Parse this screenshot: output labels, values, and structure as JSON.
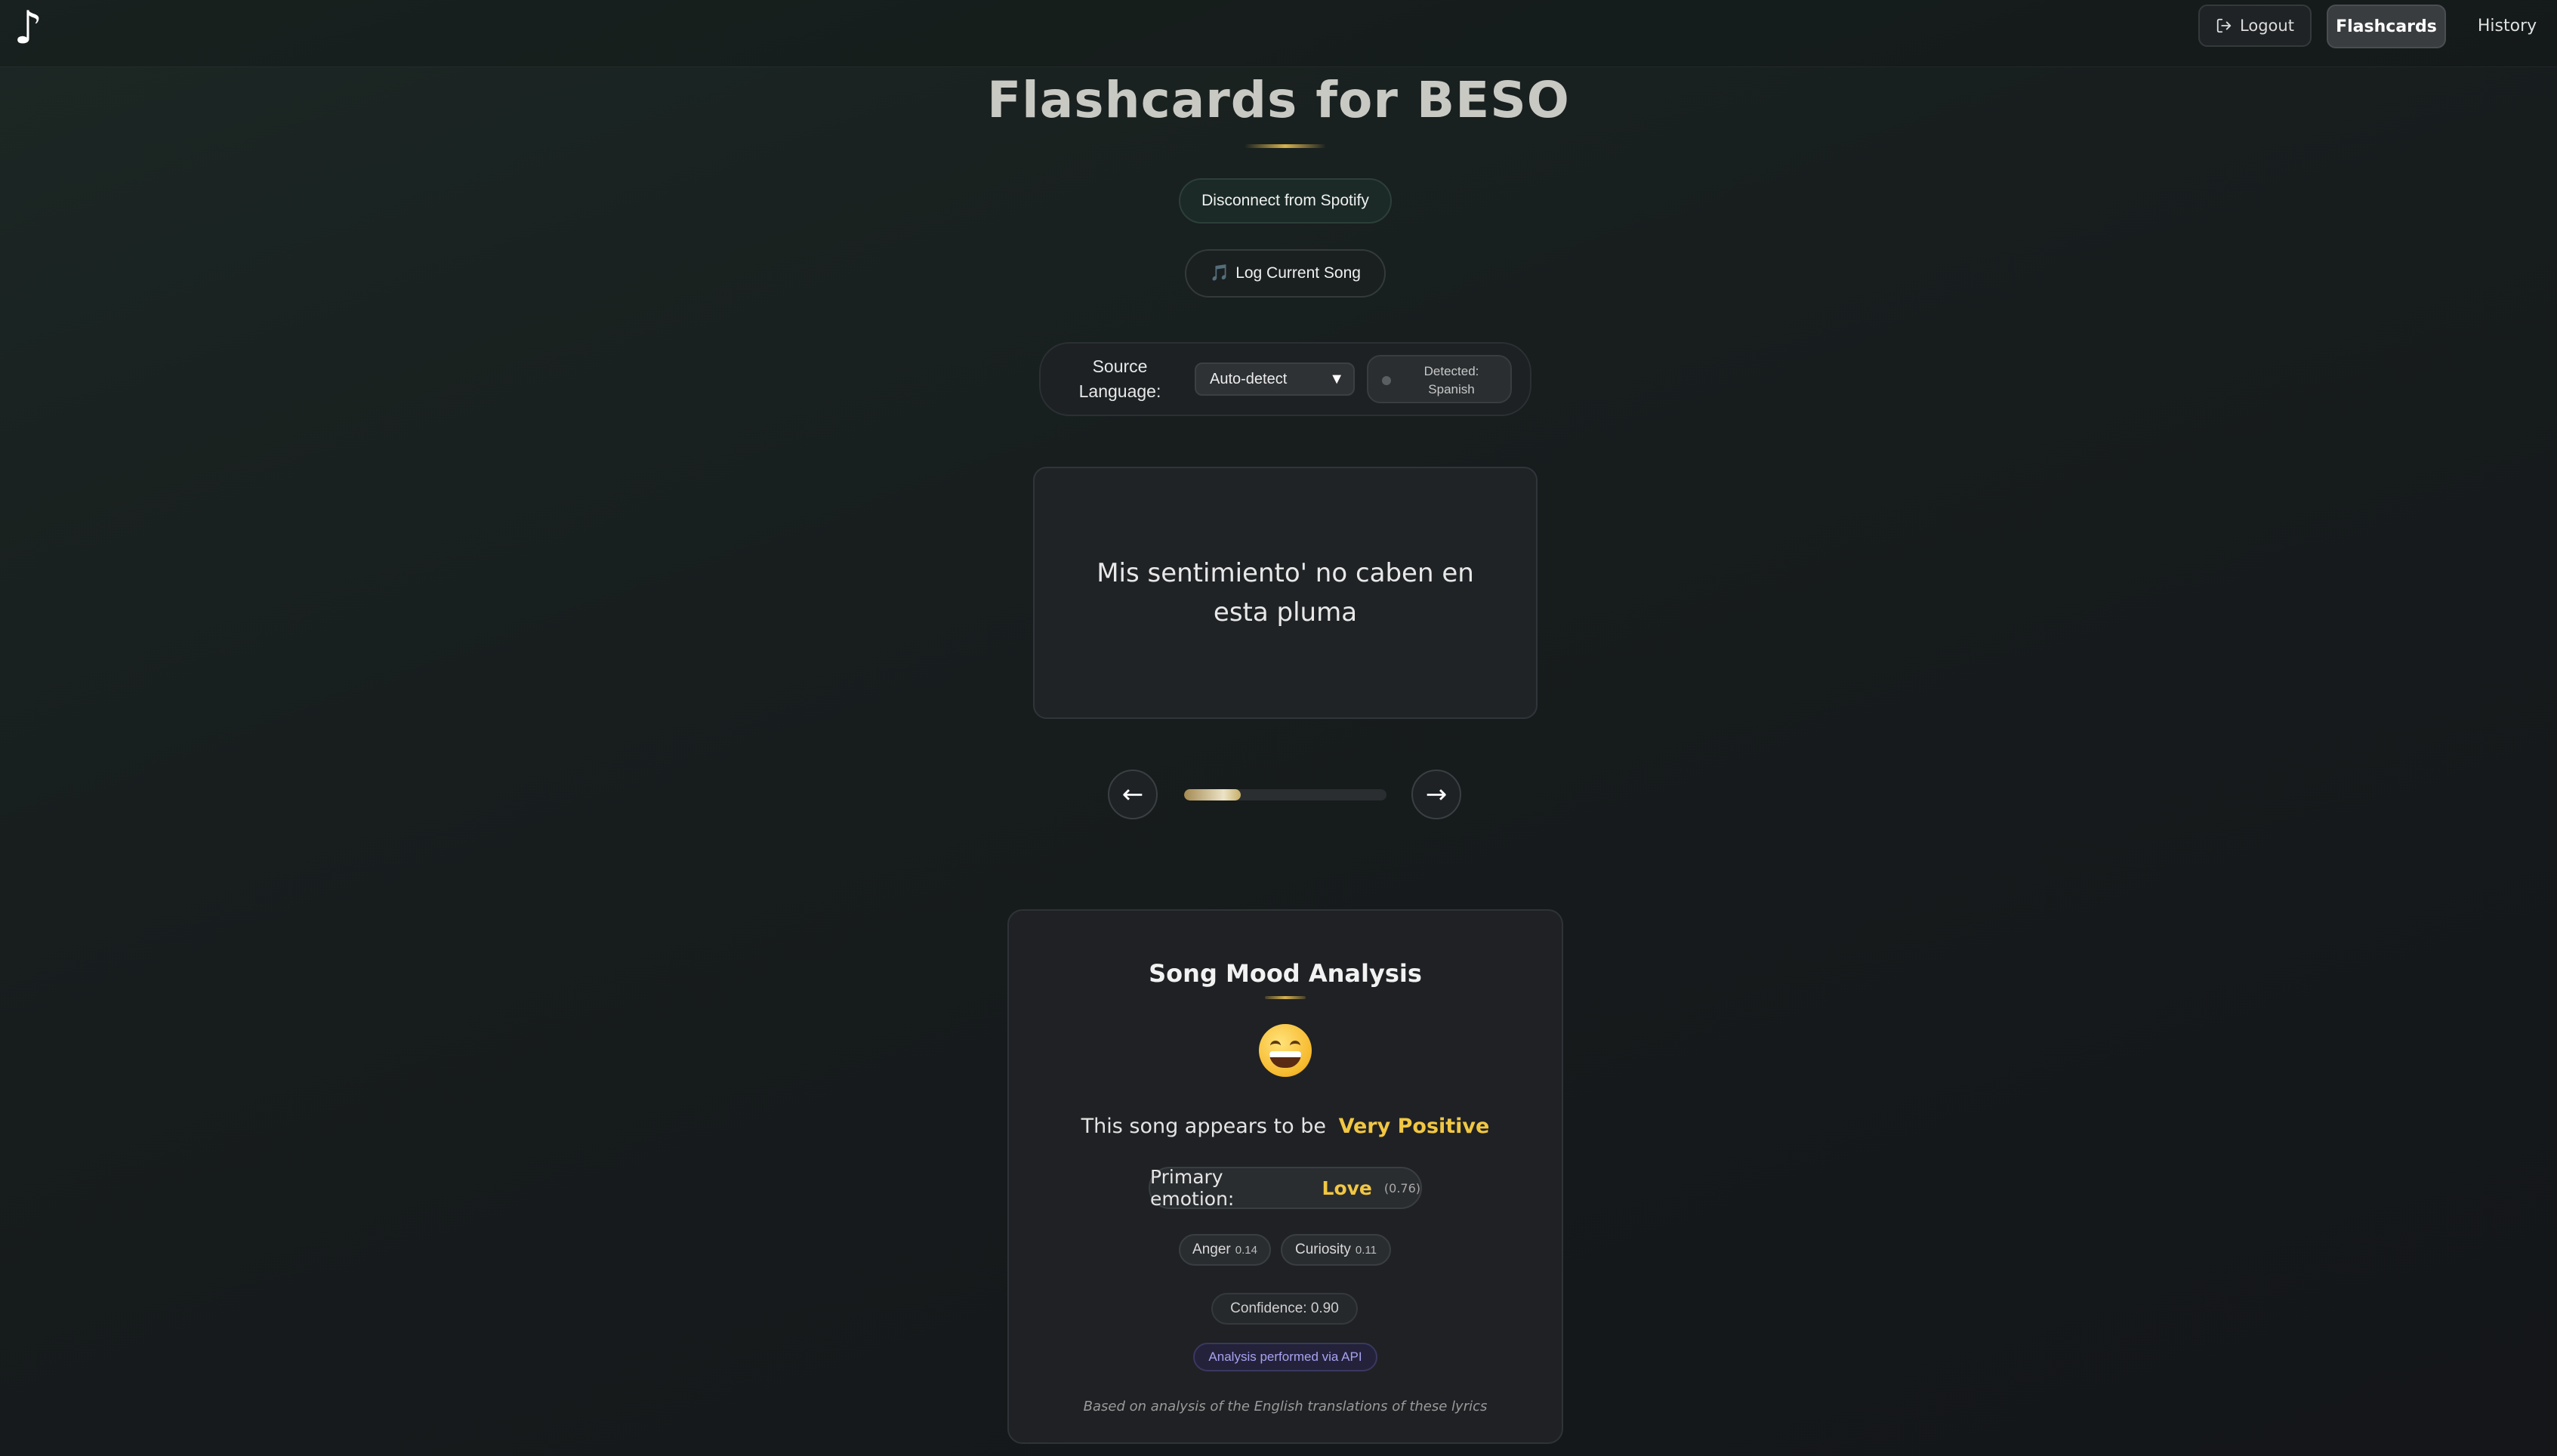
{
  "navbar": {
    "logo_glyph": "♪",
    "logout_label": "Logout",
    "flashcards_label": "Flashcards",
    "history_label": "History"
  },
  "page": {
    "title": "Flashcards for BESO"
  },
  "actions": {
    "spotify_label": "Disconnect from Spotify",
    "log_song_icon": "🎵",
    "log_song_label": "Log Current Song"
  },
  "language": {
    "label_line1": "Source",
    "label_line2": "Language:",
    "selected": "Auto-detect",
    "detected_label": "Detected:",
    "detected_value": "Spanish"
  },
  "flashcard": {
    "text": "Mis sentimiento' no caben en esta pluma",
    "progress_fraction": 0.28
  },
  "nav_arrows": {
    "prev": "←",
    "next": "→"
  },
  "mood": {
    "title": "Song Mood Analysis",
    "emoji_icon": "grinning-face-icon",
    "sentiment_prefix": "This song appears to be",
    "sentiment_value": "Very Positive",
    "primary_label": "Primary emotion:",
    "primary_value": "Love",
    "primary_score": "(0.76)",
    "emotions": [
      {
        "name": "Anger",
        "score": "0.14"
      },
      {
        "name": "Curiosity",
        "score": "0.11"
      }
    ],
    "confidence": "Confidence: 0.90",
    "api_note": "Analysis performed via API",
    "footer": "Based on analysis of the English translations of these lyrics"
  },
  "colors": {
    "accent_gold": "#f1c743",
    "api_purple": "#a9a2f0"
  }
}
